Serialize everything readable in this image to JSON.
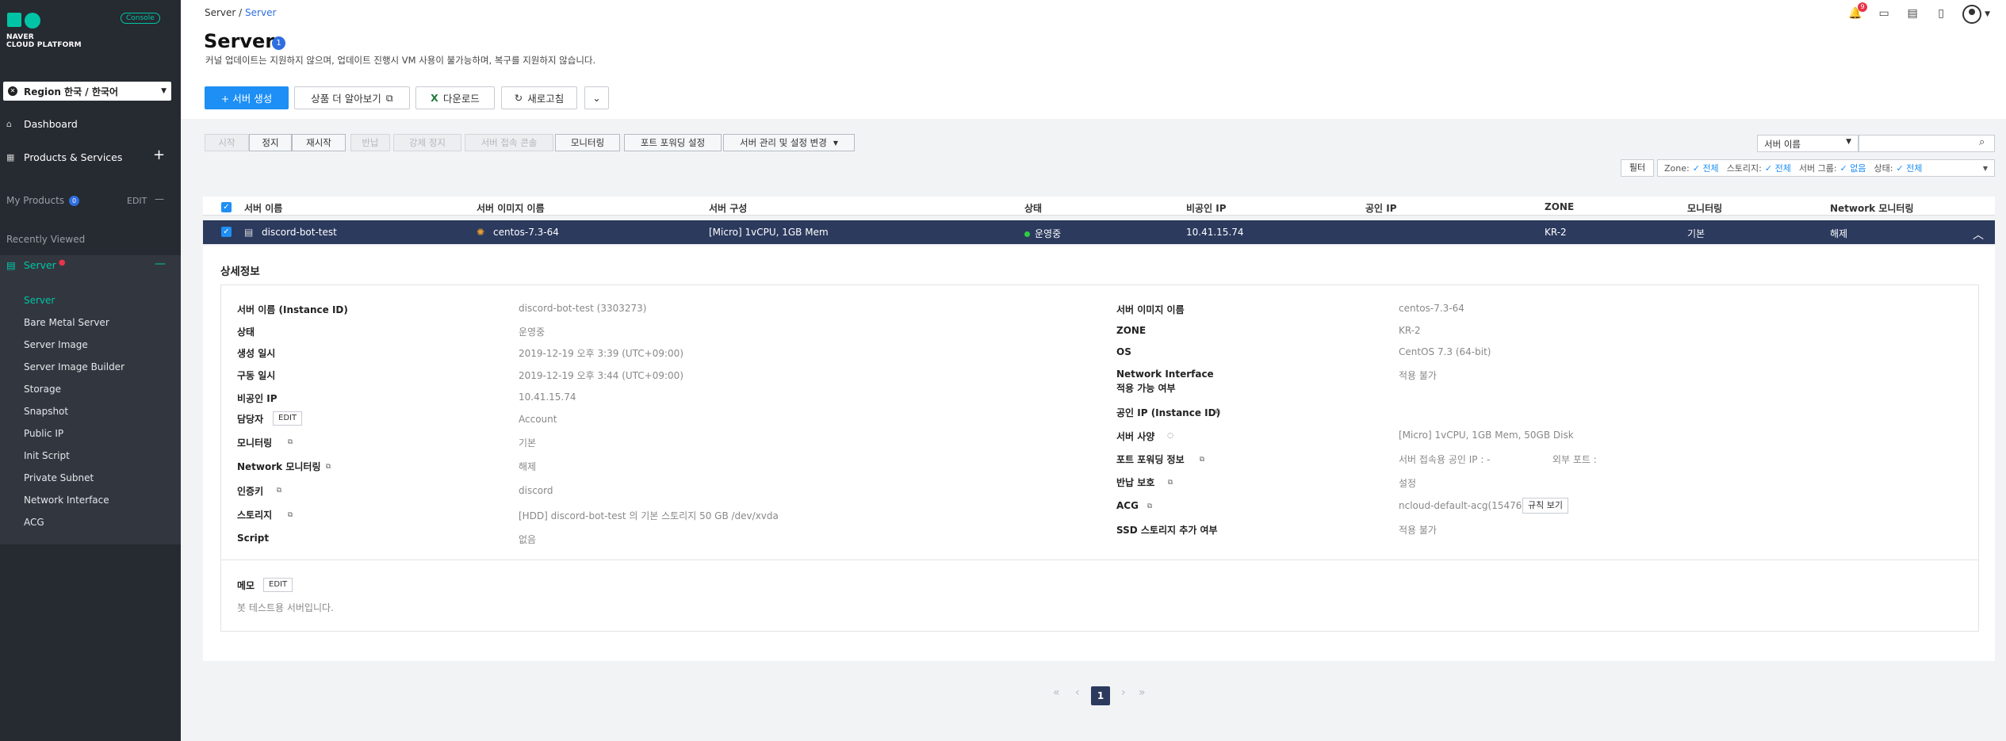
{
  "sidebar": {
    "brand_line1": "NAVER",
    "brand_line2": "CLOUD PLATFORM",
    "console_label": "Console",
    "region_label": "Region 한국 / 한국어",
    "dashboard": "Dashboard",
    "products": "Products & Services",
    "my_products": "My Products",
    "my_products_count": "0",
    "my_products_edit": "EDIT",
    "recently_viewed": "Recently Viewed",
    "server_group": "Server",
    "items": [
      "Server",
      "Bare Metal Server",
      "Server Image",
      "Server Image Builder",
      "Storage",
      "Snapshot",
      "Public IP",
      "Init Script",
      "Private Subnet",
      "Network Interface",
      "ACG"
    ]
  },
  "header": {
    "breadcrumb_root": "Server /",
    "breadcrumb_current": "Server",
    "title": "Server",
    "title_count": "1",
    "notice": "커널 업데이트는 지원하지 않으며, 업데이트 진행시 VM 사용이 불가능하며, 복구를 지원하지 않습니다.",
    "notification_count": "9"
  },
  "toolbar": {
    "create": "+ 서버 생성",
    "learn_more": "상품 더 알아보기",
    "download": "다운로드",
    "refresh": "새로고침"
  },
  "actions": [
    "시작",
    "정지",
    "재시작",
    "반납",
    "강제 정지",
    "서버 접속 콘솔",
    "모니터링",
    "포트 포워딩 설정",
    "서버 관리 및 설정 변경"
  ],
  "search": {
    "select": "서버 이름"
  },
  "filter": {
    "button": "필터",
    "zone_label": "Zone:",
    "zone_value": "전체",
    "storage_label": "스토리지:",
    "storage_value": "전체",
    "group_label": "서버 그룹:",
    "group_value": "없음",
    "status_label": "상태:",
    "status_value": "전체"
  },
  "table": {
    "headers": [
      "서버 이름",
      "서버 이미지 이름",
      "서버 구성",
      "상태",
      "비공인 IP",
      "공인 IP",
      "ZONE",
      "모니터링",
      "Network 모니터링"
    ],
    "row": {
      "name": "discord-bot-test",
      "image": "centos-7.3-64",
      "spec": "[Micro] 1vCPU, 1GB Mem",
      "status": "운영중",
      "private_ip": "10.41.15.74",
      "public_ip": "",
      "zone": "KR-2",
      "monitoring": "기본",
      "net_monitoring": "해제"
    }
  },
  "detail": {
    "title": "상세정보",
    "left": [
      {
        "label": "서버 이름 (Instance ID)",
        "value": "discord-bot-test (3303273)"
      },
      {
        "label": "상태",
        "value": "운영중"
      },
      {
        "label": "생성 일시",
        "value": "2019-12-19 오후 3:39 (UTC+09:00)"
      },
      {
        "label": "구동 일시",
        "value": "2019-12-19 오후 3:44 (UTC+09:00)"
      },
      {
        "label": "비공인 IP",
        "value": "10.41.15.74"
      },
      {
        "label": "담당자",
        "value": "Account"
      },
      {
        "label": "모니터링",
        "value": "기본"
      },
      {
        "label": "Network 모니터링",
        "value": "해제"
      },
      {
        "label": "인증키",
        "value": "discord"
      },
      {
        "label": "스토리지",
        "value": "[HDD] discord-bot-test 의 기본 스토리지  50 GB /dev/xvda"
      },
      {
        "label": "Script",
        "value": "없음"
      }
    ],
    "right": [
      {
        "label": "서버 이미지 이름",
        "value": "centos-7.3-64"
      },
      {
        "label": "ZONE",
        "value": "KR-2"
      },
      {
        "label": "OS",
        "value": "CentOS 7.3 (64-bit)"
      },
      {
        "label": "Network Interface",
        "label2": "적용 가능 여부",
        "value": "적용 불가"
      },
      {
        "label": "공인 IP (Instance ID)",
        "value": ""
      },
      {
        "label": "서버 사양",
        "value": "[Micro] 1vCPU, 1GB Mem, 50GB Disk"
      },
      {
        "label": "포트 포워딩 정보",
        "value": "서버 접속용 공인 IP : -",
        "value2": "외부 포트 :"
      },
      {
        "label": "반납 보호",
        "value": "설정"
      },
      {
        "label": "ACG",
        "value": "ncloud-default-acg(154763)",
        "button": "규칙 보기"
      },
      {
        "label": "SSD 스토리지 추가 여부",
        "value": "적용 불가"
      }
    ],
    "edit_label": "EDIT",
    "memo_label": "메모",
    "memo_value": "봇 테스트용 서버입니다."
  },
  "pagination": {
    "current": "1"
  }
}
